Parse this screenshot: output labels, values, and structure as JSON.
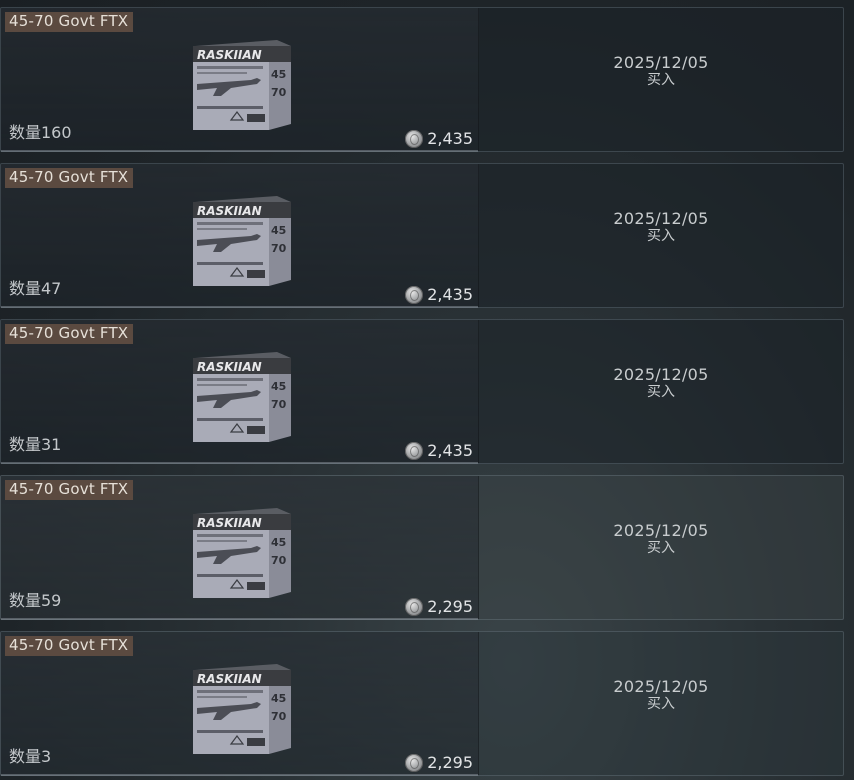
{
  "listings": [
    {
      "name": "45-70 Govt FTX",
      "quantity": "数量160",
      "price": "2,435",
      "date": "2025/12/05",
      "action": "买入",
      "icon": "ammo-box-icon"
    },
    {
      "name": "45-70 Govt FTX",
      "quantity": "数量47",
      "price": "2,435",
      "date": "2025/12/05",
      "action": "买入",
      "icon": "ammo-box-icon"
    },
    {
      "name": "45-70 Govt FTX",
      "quantity": "数量31",
      "price": "2,435",
      "date": "2025/12/05",
      "action": "买入",
      "icon": "ammo-box-icon"
    },
    {
      "name": "45-70 Govt FTX",
      "quantity": "数量59",
      "price": "2,295",
      "date": "2025/12/05",
      "action": "买入",
      "icon": "ammo-box-icon"
    },
    {
      "name": "45-70 Govt FTX",
      "quantity": "数量3",
      "price": "2,295",
      "date": "2025/12/05",
      "action": "买入",
      "icon": "ammo-box-icon"
    }
  ],
  "box_brand": "RASKIIAN",
  "box_caliber_top": "45",
  "box_caliber_bottom": "70",
  "colors": {
    "name_tag_bg": "#5b4a40",
    "text": "#c8ccce"
  }
}
